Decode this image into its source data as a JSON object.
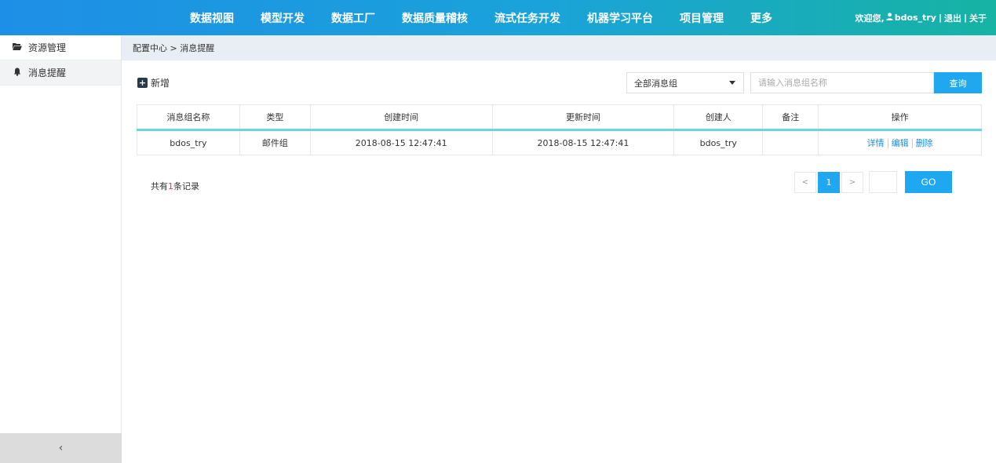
{
  "nav": {
    "items": [
      "数据视图",
      "模型开发",
      "数据工厂",
      "数据质量稽核",
      "流式任务开发",
      "机器学习平台",
      "项目管理",
      "更多"
    ]
  },
  "userbar": {
    "welcome": "欢迎您,",
    "user_icon": "user-icon",
    "username": "bdos_try",
    "logout": "退出",
    "about": "关于",
    "separator": "|"
  },
  "sidebar": {
    "items": [
      {
        "icon": "folder-open-icon",
        "label": "资源管理"
      },
      {
        "icon": "bell-icon",
        "label": "消息提醒"
      }
    ],
    "collapse_icon": "chevron-left-icon",
    "collapse_glyph": "‹"
  },
  "breadcrumb": "配置中心 > 消息提醒",
  "toolbar": {
    "add_label": "新增",
    "select_value": "全部消息组",
    "search_placeholder": "请输入消息组名称",
    "search_label": "查询"
  },
  "table": {
    "headers": [
      "消息组名称",
      "类型",
      "创建时间",
      "更新时间",
      "创建人",
      "备注",
      "操作"
    ],
    "rows": [
      {
        "name": "bdos_try",
        "type": "邮件组",
        "created": "2018-08-15 12:47:41",
        "updated": "2018-08-15 12:47:41",
        "creator": "bdos_try",
        "remark": "",
        "ops": [
          "详情",
          "编辑",
          "删除"
        ]
      }
    ]
  },
  "footer": {
    "total_prefix": "共有",
    "total_count": "1",
    "total_suffix": "条记录",
    "prev_label": "<",
    "page": "1",
    "next_label": ">",
    "go_label": "GO"
  },
  "colors": {
    "accent": "#1fa8f0",
    "link": "#1a8fe0",
    "count_highlight": "#e4393c"
  }
}
